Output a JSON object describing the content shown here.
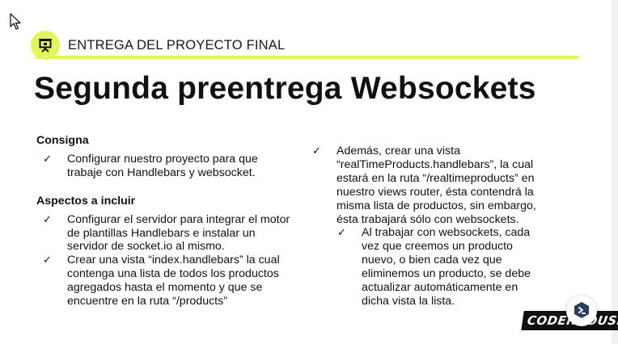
{
  "colors": {
    "accent": "#e3f55d",
    "text": "#111111",
    "brand_dark": "#2a3f5f"
  },
  "header": {
    "icon": "presentation-board-icon",
    "title": "ENTREGA DEL PROYECTO FINAL"
  },
  "slide": {
    "title": "Segunda preentrega Websockets"
  },
  "left_column": {
    "consigna": {
      "heading": "Consigna",
      "items": [
        {
          "check": "✓",
          "text": "Configurar nuestro proyecto para que trabaje con Handlebars y websocket."
        }
      ]
    },
    "aspectos": {
      "heading": "Aspectos a incluir",
      "items": [
        {
          "check": "✓",
          "text": "Configurar el servidor para integrar el motor de plantillas Handlebars e instalar un servidor de socket.io al mismo."
        },
        {
          "check": "✓",
          "text": "Crear una vista “index.handlebars” la cual contenga una lista de todos los productos agregados hasta el momento y que se encuentre en la ruta “/products”"
        }
      ]
    }
  },
  "right_column": {
    "item": {
      "check": "✓",
      "text": "Además, crear una vista “realTimeProducts.handlebars”, la cual estará en la ruta “/realtimeproducts” en nuestro views router, ésta contendrá la misma lista de productos, sin embargo, ésta trabajará sólo con websockets."
    },
    "subitem": {
      "check": "✓",
      "text": "Al trabajar con websockets, cada vez que creemos un producto nuevo, o bien cada vez que eliminemos un producto, se debe actualizar automáticamente en dicha vista la lista."
    }
  },
  "brand": {
    "logo_text": "CODERHOUSE"
  },
  "help_button": {
    "icon": "chat-help-icon"
  }
}
